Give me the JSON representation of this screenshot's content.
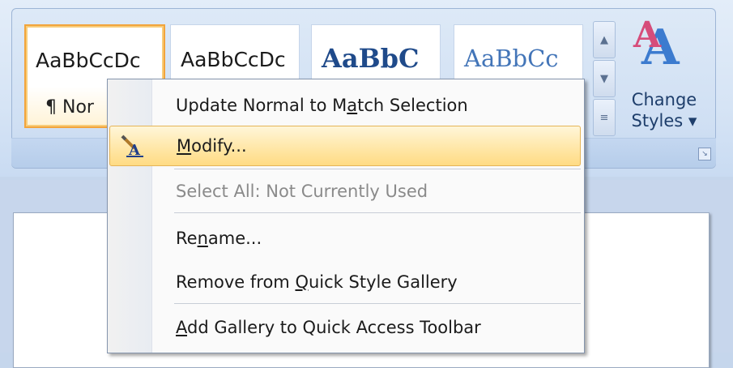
{
  "ribbon": {
    "tiles": [
      {
        "sample": "AaBbCcDc",
        "caption": "¶ Nor"
      },
      {
        "sample": "AaBbCcDc"
      },
      {
        "sample": "AaBbC"
      },
      {
        "sample": "AaBbCc"
      }
    ],
    "change_styles": {
      "line1": "Change",
      "line2": "Styles ▾"
    }
  },
  "context_menu": {
    "items": [
      {
        "pre": "Update Normal to M",
        "ul": "a",
        "post": "tch Selection",
        "enabled": true
      },
      {
        "pre": "",
        "ul": "M",
        "post": "odify...",
        "enabled": true,
        "highlighted": true,
        "icon": "modify-style-icon"
      },
      {
        "pre": "Select All: Not Currently Used",
        "ul": "",
        "post": "",
        "enabled": false
      },
      {
        "pre": "Re",
        "ul": "n",
        "post": "ame...",
        "enabled": true
      },
      {
        "pre": "Remove from ",
        "ul": "Q",
        "post": "uick Style Gallery",
        "enabled": true
      },
      {
        "pre": "",
        "ul": "A",
        "post": "dd Gallery to Quick Access Toolbar",
        "enabled": true
      }
    ]
  },
  "colors": {
    "highlight": "#ffe7a8",
    "selected_tile_border": "#f2a43c",
    "ribbon": "#d6e4f5"
  }
}
